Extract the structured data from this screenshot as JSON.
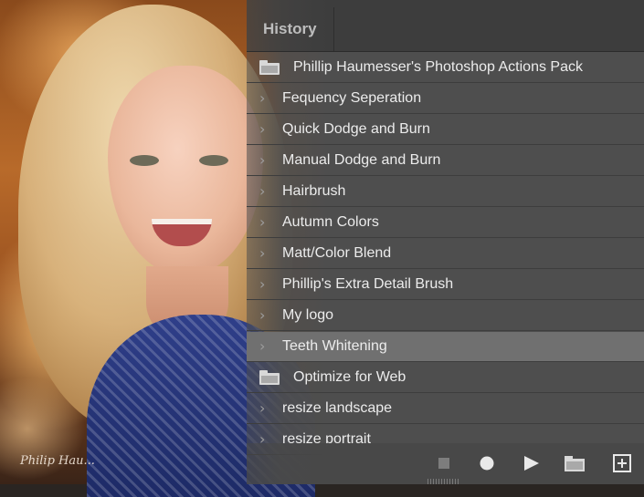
{
  "panel": {
    "tab_label": "History"
  },
  "actions": [
    {
      "type": "set",
      "label": "Phillip Haumesser's Photoshop Actions Pack",
      "selected": false
    },
    {
      "type": "action",
      "label": "Fequency Seperation",
      "selected": false
    },
    {
      "type": "action",
      "label": "Quick Dodge and Burn",
      "selected": false
    },
    {
      "type": "action",
      "label": "Manual Dodge and Burn",
      "selected": false
    },
    {
      "type": "action",
      "label": "Hairbrush",
      "selected": false
    },
    {
      "type": "action",
      "label": "Autumn Colors",
      "selected": false
    },
    {
      "type": "action",
      "label": "Matt/Color Blend",
      "selected": false
    },
    {
      "type": "action",
      "label": "Phillip's Extra Detail Brush",
      "selected": false
    },
    {
      "type": "action",
      "label": "My logo",
      "selected": false
    },
    {
      "type": "action",
      "label": "Teeth Whitening",
      "selected": true
    },
    {
      "type": "set",
      "label": "Optimize for Web",
      "selected": false
    },
    {
      "type": "action",
      "label": "resize landscape",
      "selected": false
    },
    {
      "type": "action",
      "label": "resize portrait",
      "selected": false
    }
  ],
  "toolbar": {
    "icons": [
      "stop-icon",
      "record-icon",
      "play-icon",
      "new-set-folder-icon",
      "new-action-icon"
    ]
  },
  "photo": {
    "signature": "Philip Hau..."
  },
  "colors": {
    "panel_bg": "#4e4e4e",
    "row_selected": "#707070",
    "header_bg": "#3d3d3d",
    "text": "#ececec",
    "icon": "#d8d8d8"
  }
}
